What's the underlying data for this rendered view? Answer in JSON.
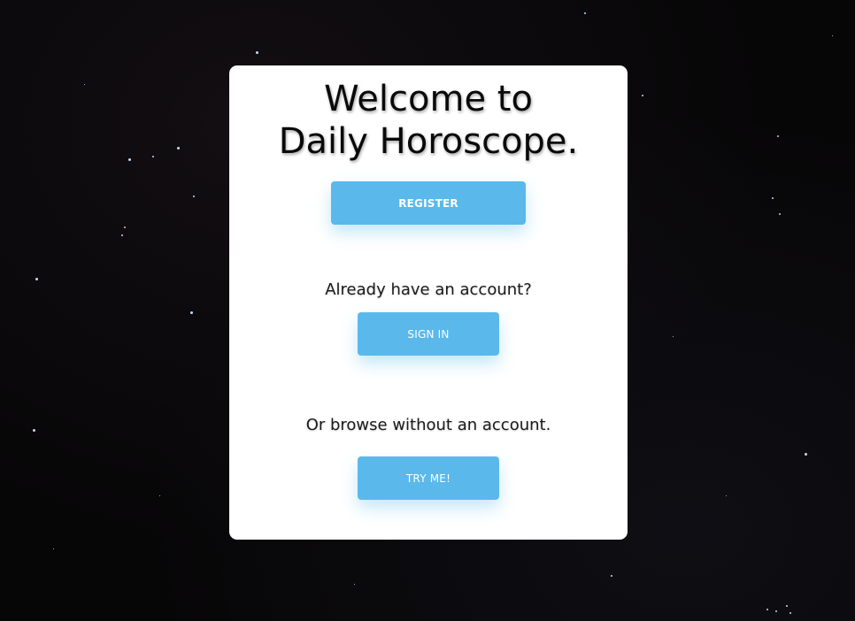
{
  "welcome": {
    "title_line1": "Welcome to",
    "title_line2": "Daily Horoscope."
  },
  "buttons": {
    "register": "REGISTER",
    "sign_in": "SIGN IN",
    "try_me": "TRY ME!"
  },
  "prompts": {
    "sign_in": "Already have an account?",
    "browse": "Or browse without an account."
  },
  "colors": {
    "button_bg": "#5ab9ea",
    "card_bg": "#ffffff",
    "page_bg": "#060506"
  }
}
